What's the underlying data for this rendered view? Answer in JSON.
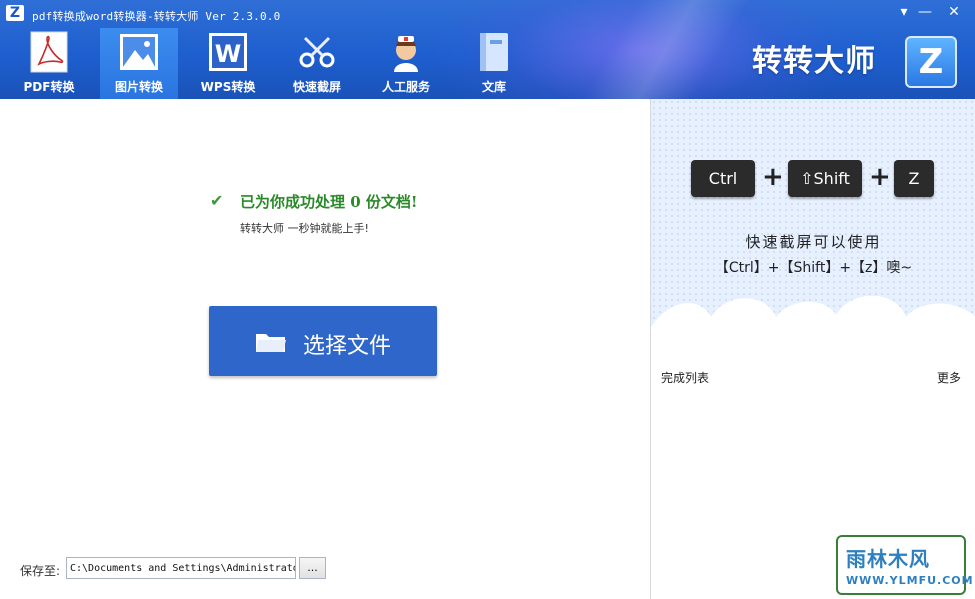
{
  "window": {
    "title": "pdf转换成word转换器-转转大师 Ver 2.3.0.0",
    "minimize_glyph": "—",
    "close_glyph": "✕",
    "dropdown_glyph": "▾"
  },
  "toolbar": {
    "items": [
      {
        "label": "PDF转换",
        "icon": "pdf-icon",
        "active": false
      },
      {
        "label": "图片转换",
        "icon": "image-icon",
        "active": true
      },
      {
        "label": "WPS转换",
        "icon": "wps-icon",
        "active": false
      },
      {
        "label": "快速截屏",
        "icon": "scissors-icon",
        "active": false
      },
      {
        "label": "人工服务",
        "icon": "nurse-icon",
        "active": false
      },
      {
        "label": "文库",
        "icon": "book-icon",
        "active": false
      }
    ]
  },
  "brand": {
    "name": "转转大师",
    "logo_letter": "Z",
    "titlebar_logo": "Z"
  },
  "main": {
    "success_icon": "✔",
    "success_text": "已为你成功处理  0  份文档!",
    "sub_text": "转转大师 一秒钟就能上手!",
    "select_button": "选择文件",
    "save_label": "保存至:",
    "save_path": "C:\\Documents and Settings\\Administrato",
    "browse_label": "..."
  },
  "sidebar": {
    "keys": [
      "Ctrl",
      "⇧Shift",
      "Z"
    ],
    "plus": "+",
    "banner_line1": "快速截屏可以使用",
    "banner_line2": "【Ctrl】+【Shift】+【z】噢~",
    "done_title": "完成列表",
    "more": "更多"
  },
  "watermark": {
    "title": "雨林木风",
    "url": "WWW.YLMFU.COM"
  },
  "colors": {
    "header_blue": "#1e5fcf",
    "button_blue": "#2f66c9",
    "success_green": "#2a8a2a"
  }
}
